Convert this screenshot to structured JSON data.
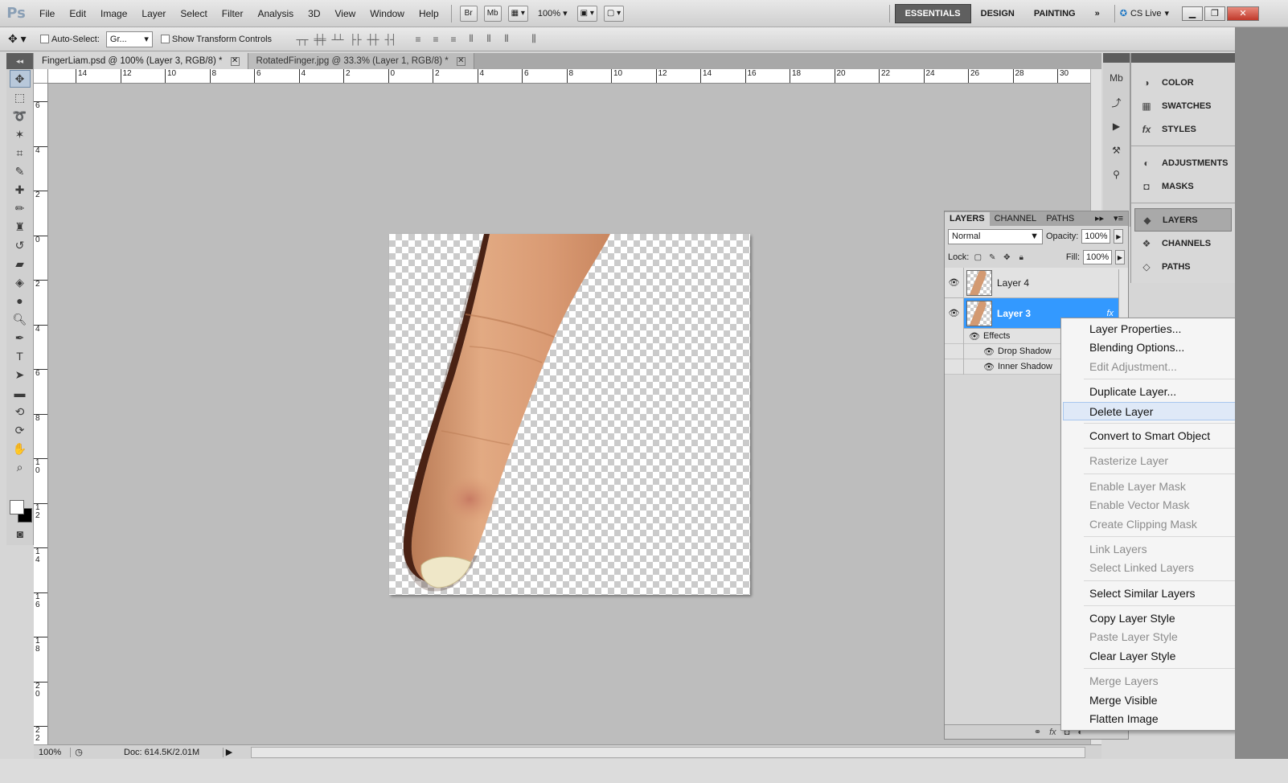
{
  "app": {
    "logo": "Ps",
    "menu": [
      "File",
      "Edit",
      "Image",
      "Layer",
      "Select",
      "Filter",
      "Analysis",
      "3D",
      "View",
      "Window",
      "Help"
    ],
    "bridge_btn": "Br",
    "minibridge_btn": "Mb",
    "zoom": "100%",
    "workspaces": [
      "ESSENTIALS",
      "DESIGN",
      "PAINTING"
    ],
    "more": "»",
    "cs_live": "CS Live"
  },
  "options": {
    "auto_select_label": "Auto-Select:",
    "auto_select_value": "Gr...",
    "show_transform_label": "Show Transform Controls"
  },
  "tabs": [
    {
      "label": "FingerLiam.psd @ 100% (Layer 3, RGB/8) *"
    },
    {
      "label": "RotatedFinger.jpg @ 33.3% (Layer 1, RGB/8) *"
    }
  ],
  "ruler_h": [
    "14",
    "12",
    "10",
    "8",
    "6",
    "4",
    "2",
    "0",
    "2",
    "4",
    "6",
    "8",
    "10",
    "12",
    "14",
    "16",
    "18",
    "20",
    "22",
    "24",
    "26",
    "28",
    "30"
  ],
  "ruler_v": [
    "6",
    "4",
    "2",
    "0",
    "2",
    "4",
    "6",
    "8",
    "1\n0",
    "1\n2",
    "1\n4",
    "1\n6",
    "1\n8",
    "2\n0",
    "2\n2"
  ],
  "status": {
    "zoom": "100%",
    "doc": "Doc: 614.5K/2.01M"
  },
  "panels": [
    {
      "label": "COLOR",
      "icon": "color-wheel-icon"
    },
    {
      "label": "SWATCHES",
      "icon": "grid-icon"
    },
    {
      "label": "STYLES",
      "icon": "fx-icon"
    },
    {
      "label": "ADJUSTMENTS",
      "icon": "adjust-icon"
    },
    {
      "label": "MASKS",
      "icon": "mask-icon"
    },
    {
      "label": "LAYERS",
      "icon": "layers-icon"
    },
    {
      "label": "CHANNELS",
      "icon": "channels-icon"
    },
    {
      "label": "PATHS",
      "icon": "paths-icon"
    }
  ],
  "layers_panel": {
    "tabs": [
      "LAYERS",
      "CHANNEL",
      "PATHS"
    ],
    "blend_mode": "Normal",
    "opacity_label": "Opacity:",
    "opacity": "100%",
    "lock_label": "Lock:",
    "fill_label": "Fill:",
    "fill": "100%",
    "layers": [
      {
        "name": "Layer 4",
        "selected": false
      },
      {
        "name": "Layer 3",
        "selected": true,
        "fx": "fx"
      }
    ],
    "effects_label": "Effects",
    "effects": [
      "Drop Shadow",
      "Inner Shadow"
    ]
  },
  "context_menu": {
    "groups": [
      [
        {
          "label": "Layer Properties...",
          "enabled": true
        },
        {
          "label": "Blending Options...",
          "enabled": true
        },
        {
          "label": "Edit Adjustment...",
          "enabled": false
        }
      ],
      [
        {
          "label": "Duplicate Layer...",
          "enabled": true
        },
        {
          "label": "Delete Layer",
          "enabled": true,
          "highlight": true
        }
      ],
      [
        {
          "label": "Convert to Smart Object",
          "enabled": true
        }
      ],
      [
        {
          "label": "Rasterize Layer",
          "enabled": false
        }
      ],
      [
        {
          "label": "Enable Layer Mask",
          "enabled": false
        },
        {
          "label": "Enable Vector Mask",
          "enabled": false
        },
        {
          "label": "Create Clipping Mask",
          "enabled": false
        }
      ],
      [
        {
          "label": "Link Layers",
          "enabled": false
        },
        {
          "label": "Select Linked Layers",
          "enabled": false
        }
      ],
      [
        {
          "label": "Select Similar Layers",
          "enabled": true
        }
      ],
      [
        {
          "label": "Copy Layer Style",
          "enabled": true
        },
        {
          "label": "Paste Layer Style",
          "enabled": false
        },
        {
          "label": "Clear Layer Style",
          "enabled": true
        }
      ],
      [
        {
          "label": "Merge Layers",
          "enabled": false
        },
        {
          "label": "Merge Visible",
          "enabled": true
        },
        {
          "label": "Flatten Image",
          "enabled": true
        }
      ]
    ]
  },
  "colors": {
    "selection_blue": "#3399ff",
    "canvas_bg": "#bdbdbd",
    "skin": "#d8a07a"
  }
}
